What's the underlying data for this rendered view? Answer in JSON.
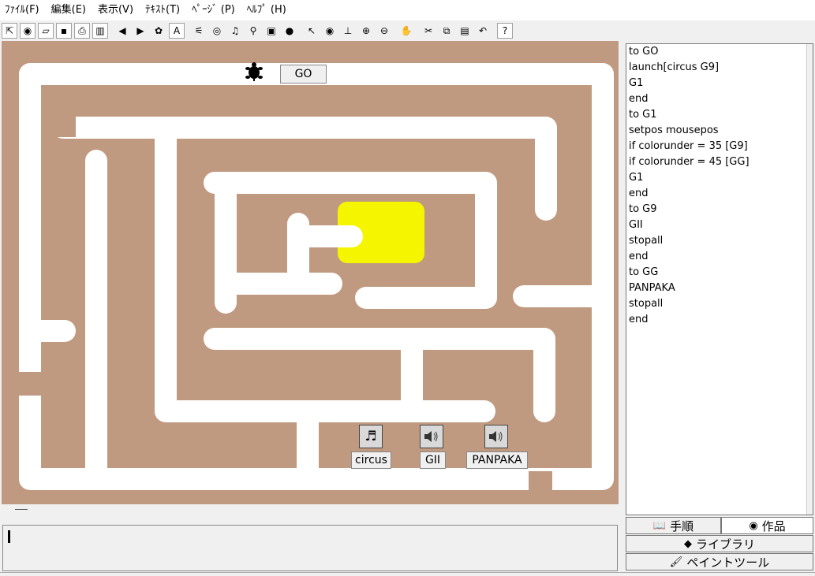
{
  "menu": [
    "ﾌｧｲﾙ(F)",
    "編集(E)",
    "表示(V)",
    "ﾃｷｽﾄ(T)",
    "ﾍﾟｰｼﾞ (P)",
    "ﾍﾙﾌﾟ (H)"
  ],
  "toolbar": {
    "icons": [
      {
        "name": "pointer-small-icon",
        "glyph": "⇱",
        "plain": false
      },
      {
        "name": "globe-icon",
        "glyph": "◉",
        "plain": false
      },
      {
        "name": "open-folder-icon",
        "glyph": "▱",
        "plain": false
      },
      {
        "name": "save-disk-icon",
        "glyph": "▪",
        "plain": false
      },
      {
        "name": "print-icon",
        "glyph": "⎙",
        "plain": false
      },
      {
        "name": "page-view-icon",
        "glyph": "▥",
        "plain": false
      },
      {
        "name": "arrow-left-icon",
        "glyph": "◀",
        "plain": true
      },
      {
        "name": "arrow-right-icon",
        "glyph": "▶",
        "plain": true
      },
      {
        "name": "new-turtle-icon",
        "glyph": "✿",
        "plain": true
      },
      {
        "name": "text-box-icon",
        "glyph": "A",
        "plain": false
      },
      {
        "name": "slider-icon",
        "glyph": "⚟",
        "plain": true
      },
      {
        "name": "button-icon",
        "glyph": "◎",
        "plain": true
      },
      {
        "name": "music-icon",
        "glyph": "♫",
        "plain": true
      },
      {
        "name": "sound-icon",
        "glyph": "⚲",
        "plain": true
      },
      {
        "name": "video-icon",
        "glyph": "▣",
        "plain": true
      },
      {
        "name": "record-icon",
        "glyph": "●",
        "plain": true
      },
      {
        "name": "select-pointer-icon",
        "glyph": "↖",
        "plain": true
      },
      {
        "name": "eye-icon",
        "glyph": "◉",
        "plain": true
      },
      {
        "name": "stamp-icon",
        "glyph": "⊥",
        "plain": true
      },
      {
        "name": "zoom-in-icon",
        "glyph": "⊕",
        "plain": true
      },
      {
        "name": "zoom-out-icon",
        "glyph": "⊖",
        "plain": true
      },
      {
        "name": "stop-hand-icon",
        "glyph": "✋",
        "plain": true
      },
      {
        "name": "scissors-icon",
        "glyph": "✂",
        "plain": true
      },
      {
        "name": "copy-icon",
        "glyph": "⧉",
        "plain": true
      },
      {
        "name": "paste-icon",
        "glyph": "▤",
        "plain": true
      },
      {
        "name": "undo-icon",
        "glyph": "↶",
        "plain": true
      },
      {
        "name": "help-icon",
        "glyph": "?",
        "plain": false
      }
    ]
  },
  "stage": {
    "go_button": "GO",
    "turtle_icon": "turtle-icon",
    "items": [
      {
        "name": "circus",
        "icon": "music-score-icon",
        "glyph": "♬"
      },
      {
        "name": "GII",
        "icon": "speaker-icon",
        "glyph": "🔈"
      },
      {
        "name": "PANPAKA",
        "icon": "speaker-icon",
        "glyph": "🔈"
      }
    ]
  },
  "procedures": [
    "to GO",
    "launch[circus  G9]",
    "G1",
    "end",
    "to G1",
    "setpos mousepos",
    "if colorunder = 35 [G9]",
    "if colorunder = 45 [GG]",
    "G1",
    "end",
    "to G9",
    "GII",
    "stopall",
    "end",
    "to GG",
    "PANPAKA",
    "stopall",
    "end"
  ],
  "tabs": {
    "procedures": "手順",
    "projects": "作品",
    "library": "ライブラリ",
    "paint_tools": "ペイントツール"
  },
  "colors": {
    "maze_background": "#c09a80",
    "maze_path": "#ffffff",
    "goal": "#f5f500"
  }
}
